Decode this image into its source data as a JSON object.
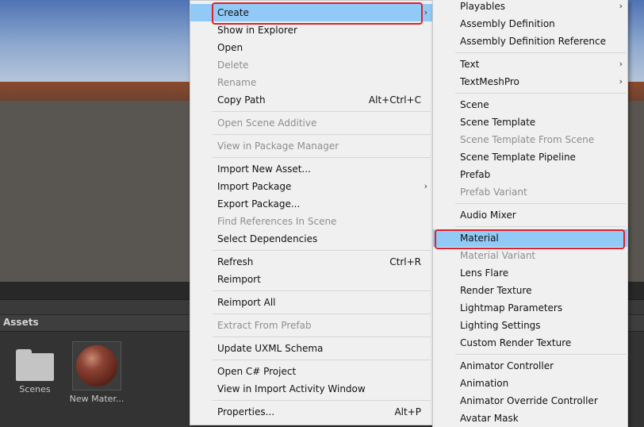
{
  "assets_panel": {
    "header": "Assets",
    "items": [
      {
        "label": "Scenes",
        "icon": "folder-icon"
      },
      {
        "label": "New Mater...",
        "icon": "material-sphere-icon"
      }
    ]
  },
  "context_menu": {
    "items": [
      {
        "label": "Create",
        "submenu": true,
        "highlighted": true
      },
      {
        "label": "Show in Explorer"
      },
      {
        "label": "Open"
      },
      {
        "label": "Delete",
        "disabled": true
      },
      {
        "label": "Rename",
        "disabled": true
      },
      {
        "label": "Copy Path",
        "shortcut": "Alt+Ctrl+C"
      },
      {
        "label": "Open Scene Additive",
        "disabled": true
      },
      {
        "label": "View in Package Manager",
        "disabled": true
      },
      {
        "label": "Import New Asset..."
      },
      {
        "label": "Import Package",
        "submenu": true
      },
      {
        "label": "Export Package..."
      },
      {
        "label": "Find References In Scene",
        "disabled": true
      },
      {
        "label": "Select Dependencies"
      },
      {
        "label": "Refresh",
        "shortcut": "Ctrl+R"
      },
      {
        "label": "Reimport"
      },
      {
        "label": "Reimport All"
      },
      {
        "label": "Extract From Prefab",
        "disabled": true
      },
      {
        "label": "Update UXML Schema"
      },
      {
        "label": "Open C# Project"
      },
      {
        "label": "View in Import Activity Window"
      },
      {
        "label": "Properties...",
        "shortcut": "Alt+P"
      }
    ]
  },
  "create_submenu": {
    "items": [
      {
        "label": "Playables",
        "submenu": true
      },
      {
        "label": "Assembly Definition"
      },
      {
        "label": "Assembly Definition Reference"
      },
      {
        "label": "Text",
        "submenu": true
      },
      {
        "label": "TextMeshPro",
        "submenu": true
      },
      {
        "label": "Scene"
      },
      {
        "label": "Scene Template"
      },
      {
        "label": "Scene Template From Scene",
        "disabled": true
      },
      {
        "label": "Scene Template Pipeline"
      },
      {
        "label": "Prefab"
      },
      {
        "label": "Prefab Variant",
        "disabled": true
      },
      {
        "label": "Audio Mixer"
      },
      {
        "label": "Material",
        "highlighted": true
      },
      {
        "label": "Material Variant",
        "disabled": true
      },
      {
        "label": "Lens Flare"
      },
      {
        "label": "Render Texture"
      },
      {
        "label": "Lightmap Parameters"
      },
      {
        "label": "Lighting Settings"
      },
      {
        "label": "Custom Render Texture"
      },
      {
        "label": "Animator Controller"
      },
      {
        "label": "Animation"
      },
      {
        "label": "Animator Override Controller"
      },
      {
        "label": "Avatar Mask"
      }
    ]
  },
  "colors": {
    "highlight": "#91c9f7",
    "annotation_box": "#e0202a",
    "menu_background": "#f0f0f0"
  }
}
